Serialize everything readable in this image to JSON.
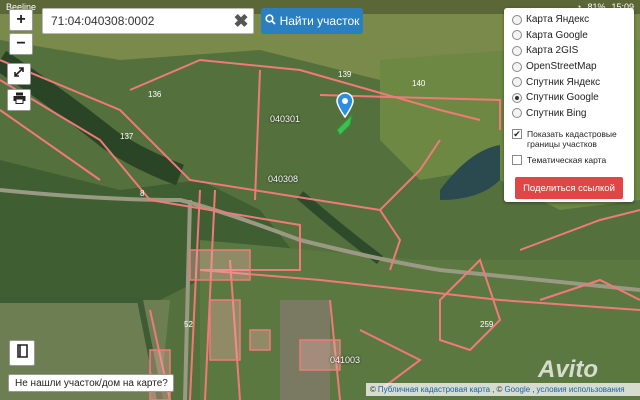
{
  "statusbar": {
    "left": "Beeline",
    "battery": "81%",
    "time": "15:09"
  },
  "search": {
    "value": "71:04:040308:0002",
    "clear_glyph": "✖",
    "button_label": "Найти участок",
    "button_icon": "search-icon"
  },
  "tools": {
    "zoom_in": "+",
    "zoom_out": "−",
    "expand_icon": "expand-icon",
    "print_icon": "print-icon",
    "book_icon": "book-icon"
  },
  "layers": {
    "items": [
      {
        "label": "Карта Яндекс",
        "selected": false
      },
      {
        "label": "Карта Google",
        "selected": false
      },
      {
        "label": "Карта 2GIS",
        "selected": false
      },
      {
        "label": "OpenStreetMap",
        "selected": false
      },
      {
        "label": "Спутник Яндекс",
        "selected": false
      },
      {
        "label": "Спутник Google",
        "selected": true
      },
      {
        "label": "Спутник Bing",
        "selected": false
      }
    ],
    "show_cadastral": "Показать кадастровые границы участков",
    "show_cadastral_checked": true,
    "thematic_map": "Тематическая карта",
    "thematic_map_checked": false,
    "share_button": "Поделиться ссылкой"
  },
  "map": {
    "labels": [
      "040301",
      "040308",
      "041003"
    ],
    "numbers": [
      "136",
      "137",
      "139",
      "140",
      "259",
      "52",
      "8"
    ],
    "marker_icon": "map-pin-icon",
    "accent_boundary": "#f07a7a"
  },
  "bottom": {
    "not_found": "Не нашли участок/дом на карте?",
    "attribution_prefix": "©",
    "attribution_link1": "Публичная кадастровая карта",
    "attribution_mid": ", ©",
    "attribution_link2": "Google",
    "attribution_link3": "условия использования",
    "watermark": "Avito"
  }
}
